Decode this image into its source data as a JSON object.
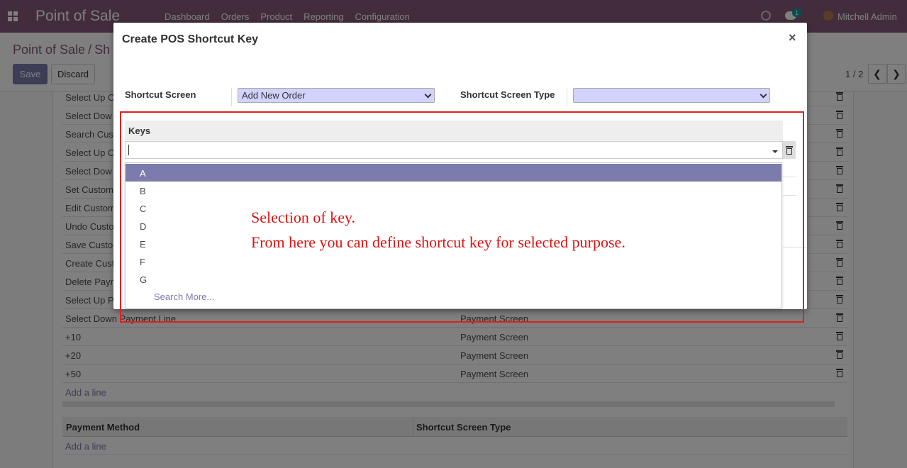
{
  "navbar": {
    "app_name": "Point of Sale",
    "menu": [
      "Dashboard",
      "Orders",
      "Product",
      "Reporting",
      "Configuration"
    ],
    "chat_badge": "1",
    "user_name": "Mitchell Admin",
    "icons": [
      "apps-icon",
      "clock-icon",
      "chat-icon",
      "avatar"
    ]
  },
  "control_panel": {
    "breadcrumb_root": "Point of Sale",
    "breadcrumb_sep": "/",
    "breadcrumb_current": "Sh",
    "save_label": "Save",
    "discard_label": "Discard",
    "pager": "1 / 2"
  },
  "background_rows": [
    {
      "name": "Select Up O",
      "screen": ""
    },
    {
      "name": "Select Dow",
      "screen": ""
    },
    {
      "name": "Search Cus",
      "screen": ""
    },
    {
      "name": "Select Up C",
      "screen": ""
    },
    {
      "name": "Select Dow",
      "screen": ""
    },
    {
      "name": "Set Custom",
      "screen": ""
    },
    {
      "name": "Edit Custom",
      "screen": ""
    },
    {
      "name": "Undo Custo",
      "screen": ""
    },
    {
      "name": "Save Custo",
      "screen": ""
    },
    {
      "name": "Create Cust",
      "screen": ""
    },
    {
      "name": "Delete Payn",
      "screen": ""
    },
    {
      "name": "Select Up Pay",
      "screen": ""
    },
    {
      "name": "Select Down Payment Line",
      "screen": "Payment Screen"
    },
    {
      "name": "+10",
      "screen": "Payment Screen"
    },
    {
      "name": "+20",
      "screen": "Payment Screen"
    },
    {
      "name": "+50",
      "screen": "Payment Screen"
    }
  ],
  "add_line_label": "Add a line",
  "payment_table": {
    "col1": "Payment Method",
    "col2": "Shortcut Screen Type",
    "add_line_label": "Add a line"
  },
  "modal": {
    "title": "Create POS Shortcut Key",
    "close_glyph": "×",
    "shortcut_screen_label": "Shortcut Screen",
    "shortcut_screen_value": "Add New Order",
    "shortcut_screen_type_label": "Shortcut Screen Type",
    "shortcut_screen_type_value": "",
    "keys_header": "Keys",
    "key_input_value": ""
  },
  "dropdown": {
    "items": [
      "A",
      "B",
      "C",
      "D",
      "E",
      "F",
      "G"
    ],
    "active_index": 0,
    "search_more": "Search More..."
  },
  "annotation": {
    "line1": "Selection of key.",
    "line2": "From here you can define shortcut key for selected purpose.",
    "color": "#e01010"
  },
  "colors": {
    "navbar": "#875a7b",
    "primary_button": "#7c7bad",
    "select_bg": "#d2d2ff"
  }
}
